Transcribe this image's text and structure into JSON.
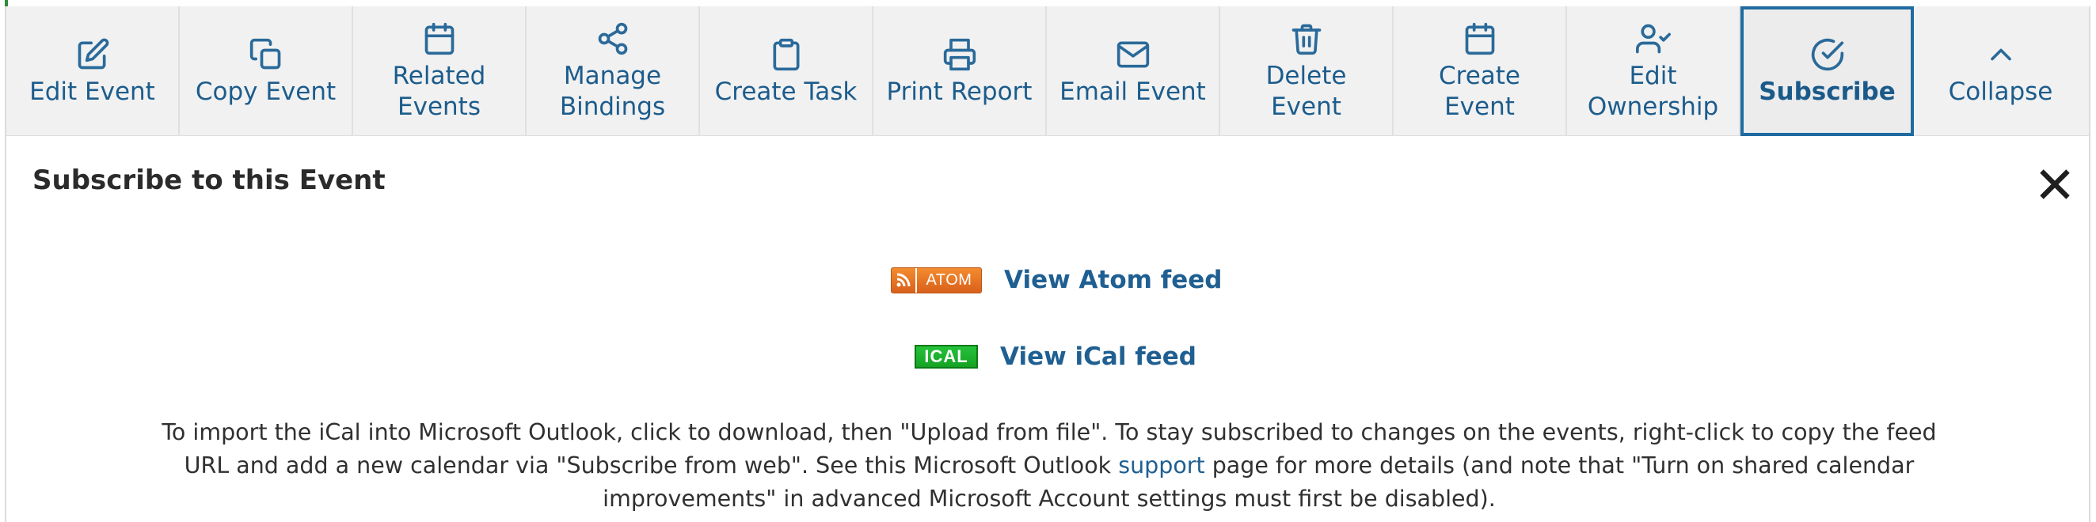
{
  "toolbar": {
    "buttons": [
      {
        "label": "Edit Event",
        "icon": "edit-icon"
      },
      {
        "label": "Copy Event",
        "icon": "copy-icon"
      },
      {
        "label": "Related\nEvents",
        "icon": "calendar-icon"
      },
      {
        "label": "Manage\nBindings",
        "icon": "share-icon"
      },
      {
        "label": "Create Task",
        "icon": "clipboard-icon"
      },
      {
        "label": "Print Report",
        "icon": "printer-icon"
      },
      {
        "label": "Email Event",
        "icon": "envelope-icon"
      },
      {
        "label": "Delete Event",
        "icon": "trash-icon"
      },
      {
        "label": "Create Event",
        "icon": "calendar-icon"
      },
      {
        "label": "Edit\nOwnership",
        "icon": "user-check-icon"
      },
      {
        "label": "Subscribe",
        "icon": "check-circle-icon",
        "active": true
      },
      {
        "label": "Collapse",
        "icon": "chevron-up-icon"
      }
    ]
  },
  "panel": {
    "title": "Subscribe to this Event",
    "atom_badge": "ATOM",
    "atom_link": "View Atom feed",
    "ical_badge": "ICAL",
    "ical_link": "View iCal feed",
    "help_before": "To import the iCal into Microsoft Outlook, click to download, then \"Upload from file\". To stay subscribed to changes on the events, right-click to copy the feed URL and add a new calendar via \"Subscribe from web\". See this Microsoft Outlook ",
    "help_link": "support",
    "help_after": " page for more details (and note that \"Turn on shared calendar improvements\" in advanced Microsoft Account settings must first be disabled)."
  },
  "colors": {
    "accent": "#1f6aa0",
    "link": "#1f5f91",
    "atom_badge": "#e8742a",
    "ical_badge": "#1fb32e"
  }
}
